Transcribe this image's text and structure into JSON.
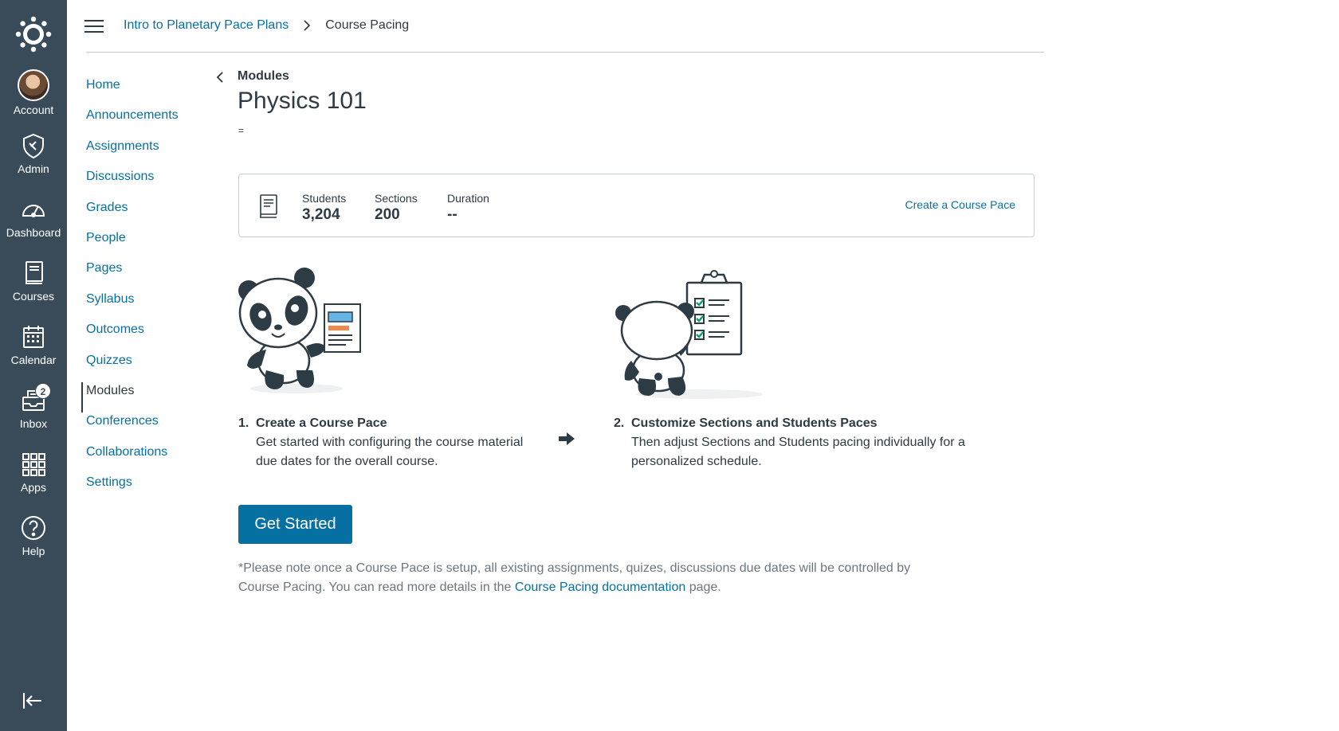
{
  "global_nav": {
    "items": [
      {
        "label": "Account",
        "icon": "avatar"
      },
      {
        "label": "Admin",
        "icon": "shield-icon"
      },
      {
        "label": "Dashboard",
        "icon": "dashboard-icon"
      },
      {
        "label": "Courses",
        "icon": "book-icon"
      },
      {
        "label": "Calendar",
        "icon": "calendar-icon"
      },
      {
        "label": "Inbox",
        "icon": "inbox-icon",
        "badge": "2"
      },
      {
        "label": "Apps",
        "icon": "apps-icon"
      },
      {
        "label": "Help",
        "icon": "help-icon"
      }
    ],
    "brand_color": "#394b58"
  },
  "breadcrumb": {
    "course": "Intro to Planetary Pace Plans",
    "current": "Course Pacing"
  },
  "course_nav": {
    "items": [
      "Home",
      "Announcements",
      "Assignments",
      "Discussions",
      "Grades",
      "People",
      "Pages",
      "Syllabus",
      "Outcomes",
      "Quizzes",
      "Modules",
      "Conferences",
      "Collaborations",
      "Settings"
    ],
    "active": "Modules"
  },
  "main": {
    "back_label": "Modules",
    "title": "Physics 101",
    "eq": "=",
    "stats": {
      "students_label": "Students",
      "students_value": "3,204",
      "sections_label": "Sections",
      "sections_value": "200",
      "duration_label": "Duration",
      "duration_value": "--"
    },
    "create_link": "Create a Course Pace",
    "step1": {
      "num": "1.",
      "title": "Create a Course Pace",
      "text": "Get started with configuring the course material due dates for the overall course."
    },
    "step2": {
      "num": "2.",
      "title": "Customize Sections and Students Paces",
      "text": "Then adjust Sections and Students pacing individually for a personalized schedule."
    },
    "button": "Get Started",
    "note_before": "*Please note once a Course Pace is setup, all existing assignments, quizes, discussions due dates will be controlled by Course Pacing. You can read more details in the ",
    "note_link": "Course Pacing documentation",
    "note_after": " page."
  },
  "colors": {
    "link": "#0770a3",
    "text": "#2d3b45",
    "button": "#0770a3"
  }
}
